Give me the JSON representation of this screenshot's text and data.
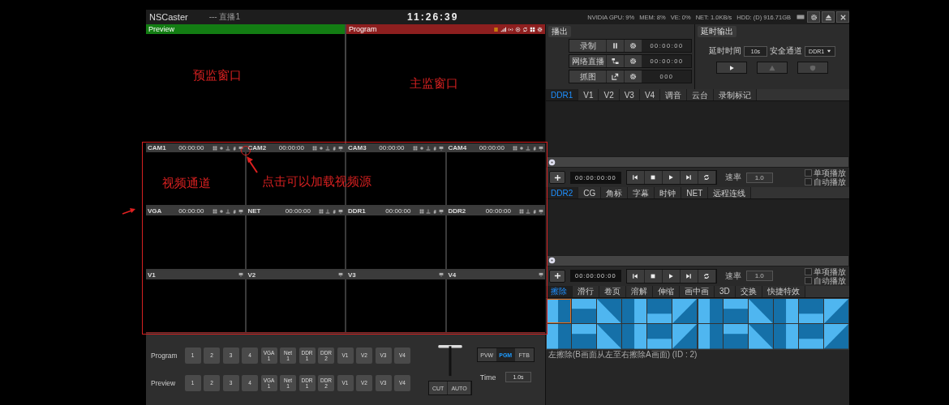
{
  "title_bar": {
    "app_name": "NSCaster",
    "session": "--- 直播1",
    "clock": "11:26:39",
    "stats": [
      "NVIDIA GPU: 9%",
      "MEM: 8%",
      "VE: 0%",
      "NET: 1.0KB/s",
      "HDD: (D) 916.71GB"
    ]
  },
  "monitors": [
    {
      "kind": "preview",
      "label": "Preview"
    },
    {
      "kind": "program",
      "label": "Program"
    }
  ],
  "channels": [
    {
      "name": "CAM1",
      "time": "00:00:00",
      "kind": "live"
    },
    {
      "name": "CAM2",
      "time": "00:00:00",
      "kind": "live"
    },
    {
      "name": "CAM3",
      "time": "00:00:00",
      "kind": "live"
    },
    {
      "name": "CAM4",
      "time": "00:00:00",
      "kind": "live"
    },
    {
      "name": "VGA",
      "time": "00:00:00",
      "kind": "live"
    },
    {
      "name": "NET",
      "time": "00:00:00",
      "kind": "file"
    },
    {
      "name": "DDR1",
      "time": "00:00:00",
      "kind": "file"
    },
    {
      "name": "DDR2",
      "time": "00:00:00",
      "kind": "file"
    },
    {
      "name": "V1",
      "kind": "virtual"
    },
    {
      "name": "V2",
      "kind": "virtual"
    },
    {
      "name": "V3",
      "kind": "virtual"
    },
    {
      "name": "V4",
      "kind": "virtual"
    }
  ],
  "switcher": {
    "rows": [
      {
        "label": "Program",
        "sources": [
          "1",
          "2",
          "3",
          "4",
          "VGA\n1",
          "Net\n1",
          "DDR\n1",
          "DDR\n2",
          "V1",
          "V2",
          "V3",
          "V4"
        ]
      },
      {
        "label": "Preview",
        "sources": [
          "1",
          "2",
          "3",
          "4",
          "VGA\n1",
          "Net\n1",
          "DDR\n1",
          "DDR\n2",
          "V1",
          "V2",
          "V3",
          "V4"
        ]
      }
    ],
    "modes": [
      {
        "label": "PVW",
        "selected": false
      },
      {
        "label": "PGM",
        "selected": true
      },
      {
        "label": "FTB",
        "selected": false
      }
    ],
    "time_label": "Time",
    "time_value": "1.0s",
    "take_buttons": [
      "CUT",
      "AUTO"
    ]
  },
  "broadcast": {
    "title": "播出",
    "rows": [
      {
        "kind": "record",
        "label": "录制",
        "counter": "00:00:00"
      },
      {
        "kind": "stream",
        "label": "网络直播",
        "counter": "00:00:00"
      },
      {
        "kind": "snapshot",
        "label": "抓图",
        "counter": "000"
      }
    ]
  },
  "delay_output": {
    "title": "延时输出",
    "delay_label": "延时时间",
    "delay_value": "10s",
    "channel_label": "安全通道",
    "channel_value": "DDR1"
  },
  "tab_bars": [
    [
      {
        "label": "DDR1",
        "selected": true
      },
      {
        "label": "V1",
        "selected": false
      },
      {
        "label": "V2",
        "selected": false
      },
      {
        "label": "V3",
        "selected": false
      },
      {
        "label": "V4",
        "selected": false
      },
      {
        "label": "调音",
        "selected": false
      },
      {
        "label": "云台",
        "selected": false
      },
      {
        "label": "录制标记",
        "selected": false
      }
    ],
    [
      {
        "label": "DDR2",
        "selected": true
      },
      {
        "label": "CG",
        "selected": false
      },
      {
        "label": "角标",
        "selected": false
      },
      {
        "label": "字幕",
        "selected": false
      },
      {
        "label": "时钟",
        "selected": false
      },
      {
        "label": "NET",
        "selected": false
      },
      {
        "label": "远程连线",
        "selected": false
      }
    ],
    [
      {
        "label": "擦除",
        "selected": true
      },
      {
        "label": "滑行",
        "selected": false
      },
      {
        "label": "卷页",
        "selected": false
      },
      {
        "label": "溶解",
        "selected": false
      },
      {
        "label": "伸缩",
        "selected": false
      },
      {
        "label": "画中画",
        "selected": false
      },
      {
        "label": "3D",
        "selected": false
      },
      {
        "label": "交换",
        "selected": false
      },
      {
        "label": "快捷特效",
        "selected": false
      }
    ]
  ],
  "players": [
    {
      "timecode": "00:00:00:00",
      "rate_label": "速率",
      "rate": "1.0",
      "options": [
        {
          "label": "单项播放",
          "checked": false
        },
        {
          "label": "自动播放",
          "checked": false
        }
      ]
    },
    {
      "timecode": "00:00:00:00",
      "rate_label": "速率",
      "rate": "1.0",
      "options": [
        {
          "label": "单项播放",
          "checked": false
        },
        {
          "label": "自动播放",
          "checked": false
        }
      ]
    }
  ],
  "transitions": [
    {
      "selected": true
    },
    {
      "selected": false
    },
    {
      "selected": false
    },
    {
      "selected": false
    },
    {
      "selected": false
    },
    {
      "selected": false
    },
    {
      "selected": false
    },
    {
      "selected": false
    },
    {
      "selected": false
    },
    {
      "selected": false
    },
    {
      "selected": false
    },
    {
      "selected": false
    },
    {
      "selected": false
    },
    {
      "selected": false
    },
    {
      "selected": false
    },
    {
      "selected": false
    },
    {
      "selected": false
    },
    {
      "selected": false
    },
    {
      "selected": false
    },
    {
      "selected": false
    },
    {
      "selected": false
    },
    {
      "selected": false
    },
    {
      "selected": false
    },
    {
      "selected": false
    }
  ],
  "status": "左擦除(B画面从左至右擦除A画面) (ID : 2)",
  "annotations": [
    {
      "text": "预监窗口"
    },
    {
      "text": "主监窗口"
    },
    {
      "text": "视频通道"
    },
    {
      "text": "点击可以加载视频源"
    }
  ]
}
